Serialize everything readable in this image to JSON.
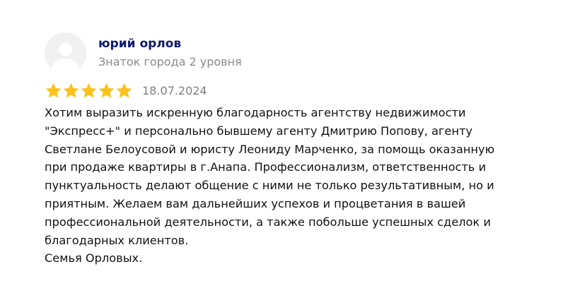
{
  "review": {
    "author": {
      "name": "юрий орлов",
      "level": "Знаток города 2 уровня",
      "avatar_icon": "user-silhouette-icon"
    },
    "rating": {
      "stars": 5,
      "max": 5,
      "star_icon": "star-icon",
      "star_color": "#fcc21b"
    },
    "date": "18.07.2024",
    "text_lines": [
      "Хотим выразить искренную благодарность агентству недвижимости",
      "\"Экспресс+\" и персонально бывшему агенту Дмитрию Попову, агенту",
      "Светлане Белоусовой и юристу Леониду Марченко, за помощь оказанную",
      "при продаже квартиры в г.Анапа. Профессионализм, ответственность и",
      "пунктуальность делают общение с ними не только результативным, но и",
      "приятным. Желаем вам дальнейших успехов и процветания в вашей",
      "профессиональной деятельности, а также побольше успешных сделок и",
      "благодарных клиентов.",
      "Семья Орловых."
    ]
  },
  "colors": {
    "author_name": "#0f1a6b",
    "secondary_text": "#8a8a8a",
    "avatar_bg": "#f1f1f1"
  }
}
